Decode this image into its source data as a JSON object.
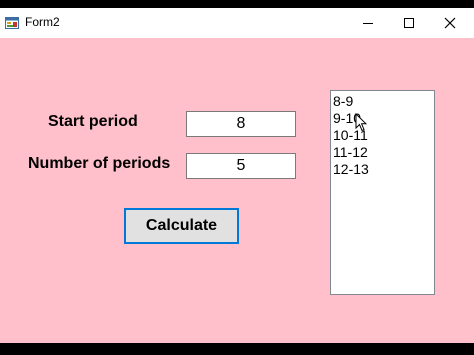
{
  "window": {
    "title": "Form2",
    "icons": {
      "app": "form-app-icon",
      "minimize": "minimize-icon",
      "maximize": "maximize-icon",
      "close": "close-icon"
    }
  },
  "form": {
    "start_period_label": "Start period",
    "start_period_value": "8",
    "num_periods_label": "Number of periods",
    "num_periods_value": "5",
    "calculate_label": "Calculate",
    "list_items": [
      "8-9",
      "9-10",
      "10-11",
      "11-12",
      "12-13"
    ]
  },
  "colors": {
    "form_background": "#ffc0cb",
    "button_border": "#0078d7"
  }
}
